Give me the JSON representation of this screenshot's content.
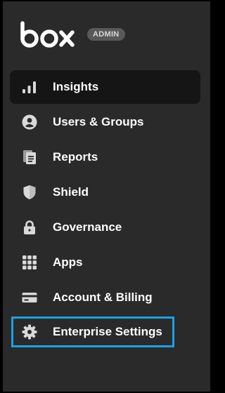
{
  "brand": {
    "logo_text": "box",
    "badge": "ADMIN"
  },
  "nav": {
    "items": [
      {
        "label": "Insights",
        "icon": "bar-chart-icon",
        "active": true
      },
      {
        "label": "Users & Groups",
        "icon": "user-icon"
      },
      {
        "label": "Reports",
        "icon": "reports-icon"
      },
      {
        "label": "Shield",
        "icon": "shield-icon"
      },
      {
        "label": "Governance",
        "icon": "lock-icon"
      },
      {
        "label": "Apps",
        "icon": "apps-grid-icon"
      },
      {
        "label": "Account & Billing",
        "icon": "credit-card-icon"
      },
      {
        "label": "Enterprise Settings",
        "icon": "gear-icon",
        "highlighted": true
      }
    ]
  },
  "colors": {
    "background": "#2a2a2a",
    "active_item": "#151515",
    "icon": "#d9d9d9",
    "highlight_outline": "#1aa1e6"
  }
}
